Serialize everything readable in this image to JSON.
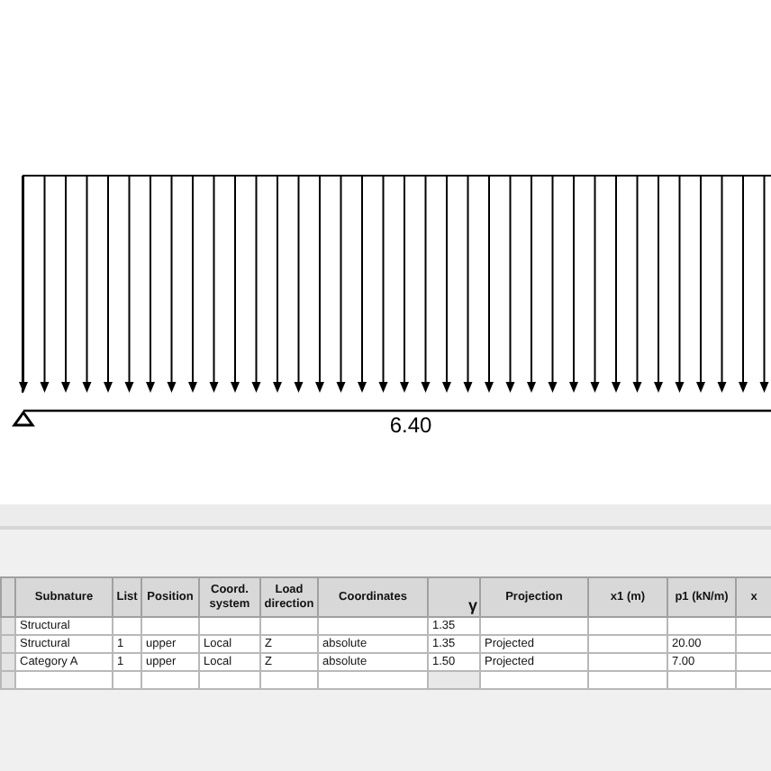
{
  "beam": {
    "span_label": "6.40"
  },
  "table": {
    "columns": [
      "Subnature",
      "List",
      "Position",
      "Coord. system",
      "Load direction",
      "Coordinates",
      "γ",
      "Projection",
      "x1 (m)",
      "p1 (kN/m)",
      "x"
    ],
    "rows": [
      [
        "Structural",
        null,
        null,
        null,
        null,
        null,
        "1.35",
        null,
        null,
        null,
        null
      ],
      [
        "Structural",
        "1",
        "upper",
        "Local",
        "Z",
        "absolute",
        "1.35",
        "Projected",
        null,
        "20.00",
        null
      ],
      [
        "Category A",
        "1",
        "upper",
        "Local",
        "Z",
        "absolute",
        "1.50",
        "Projected",
        null,
        "7.00",
        null
      ],
      [
        null,
        null,
        null,
        null,
        null,
        null,
        null,
        null,
        null,
        null,
        null
      ]
    ]
  }
}
